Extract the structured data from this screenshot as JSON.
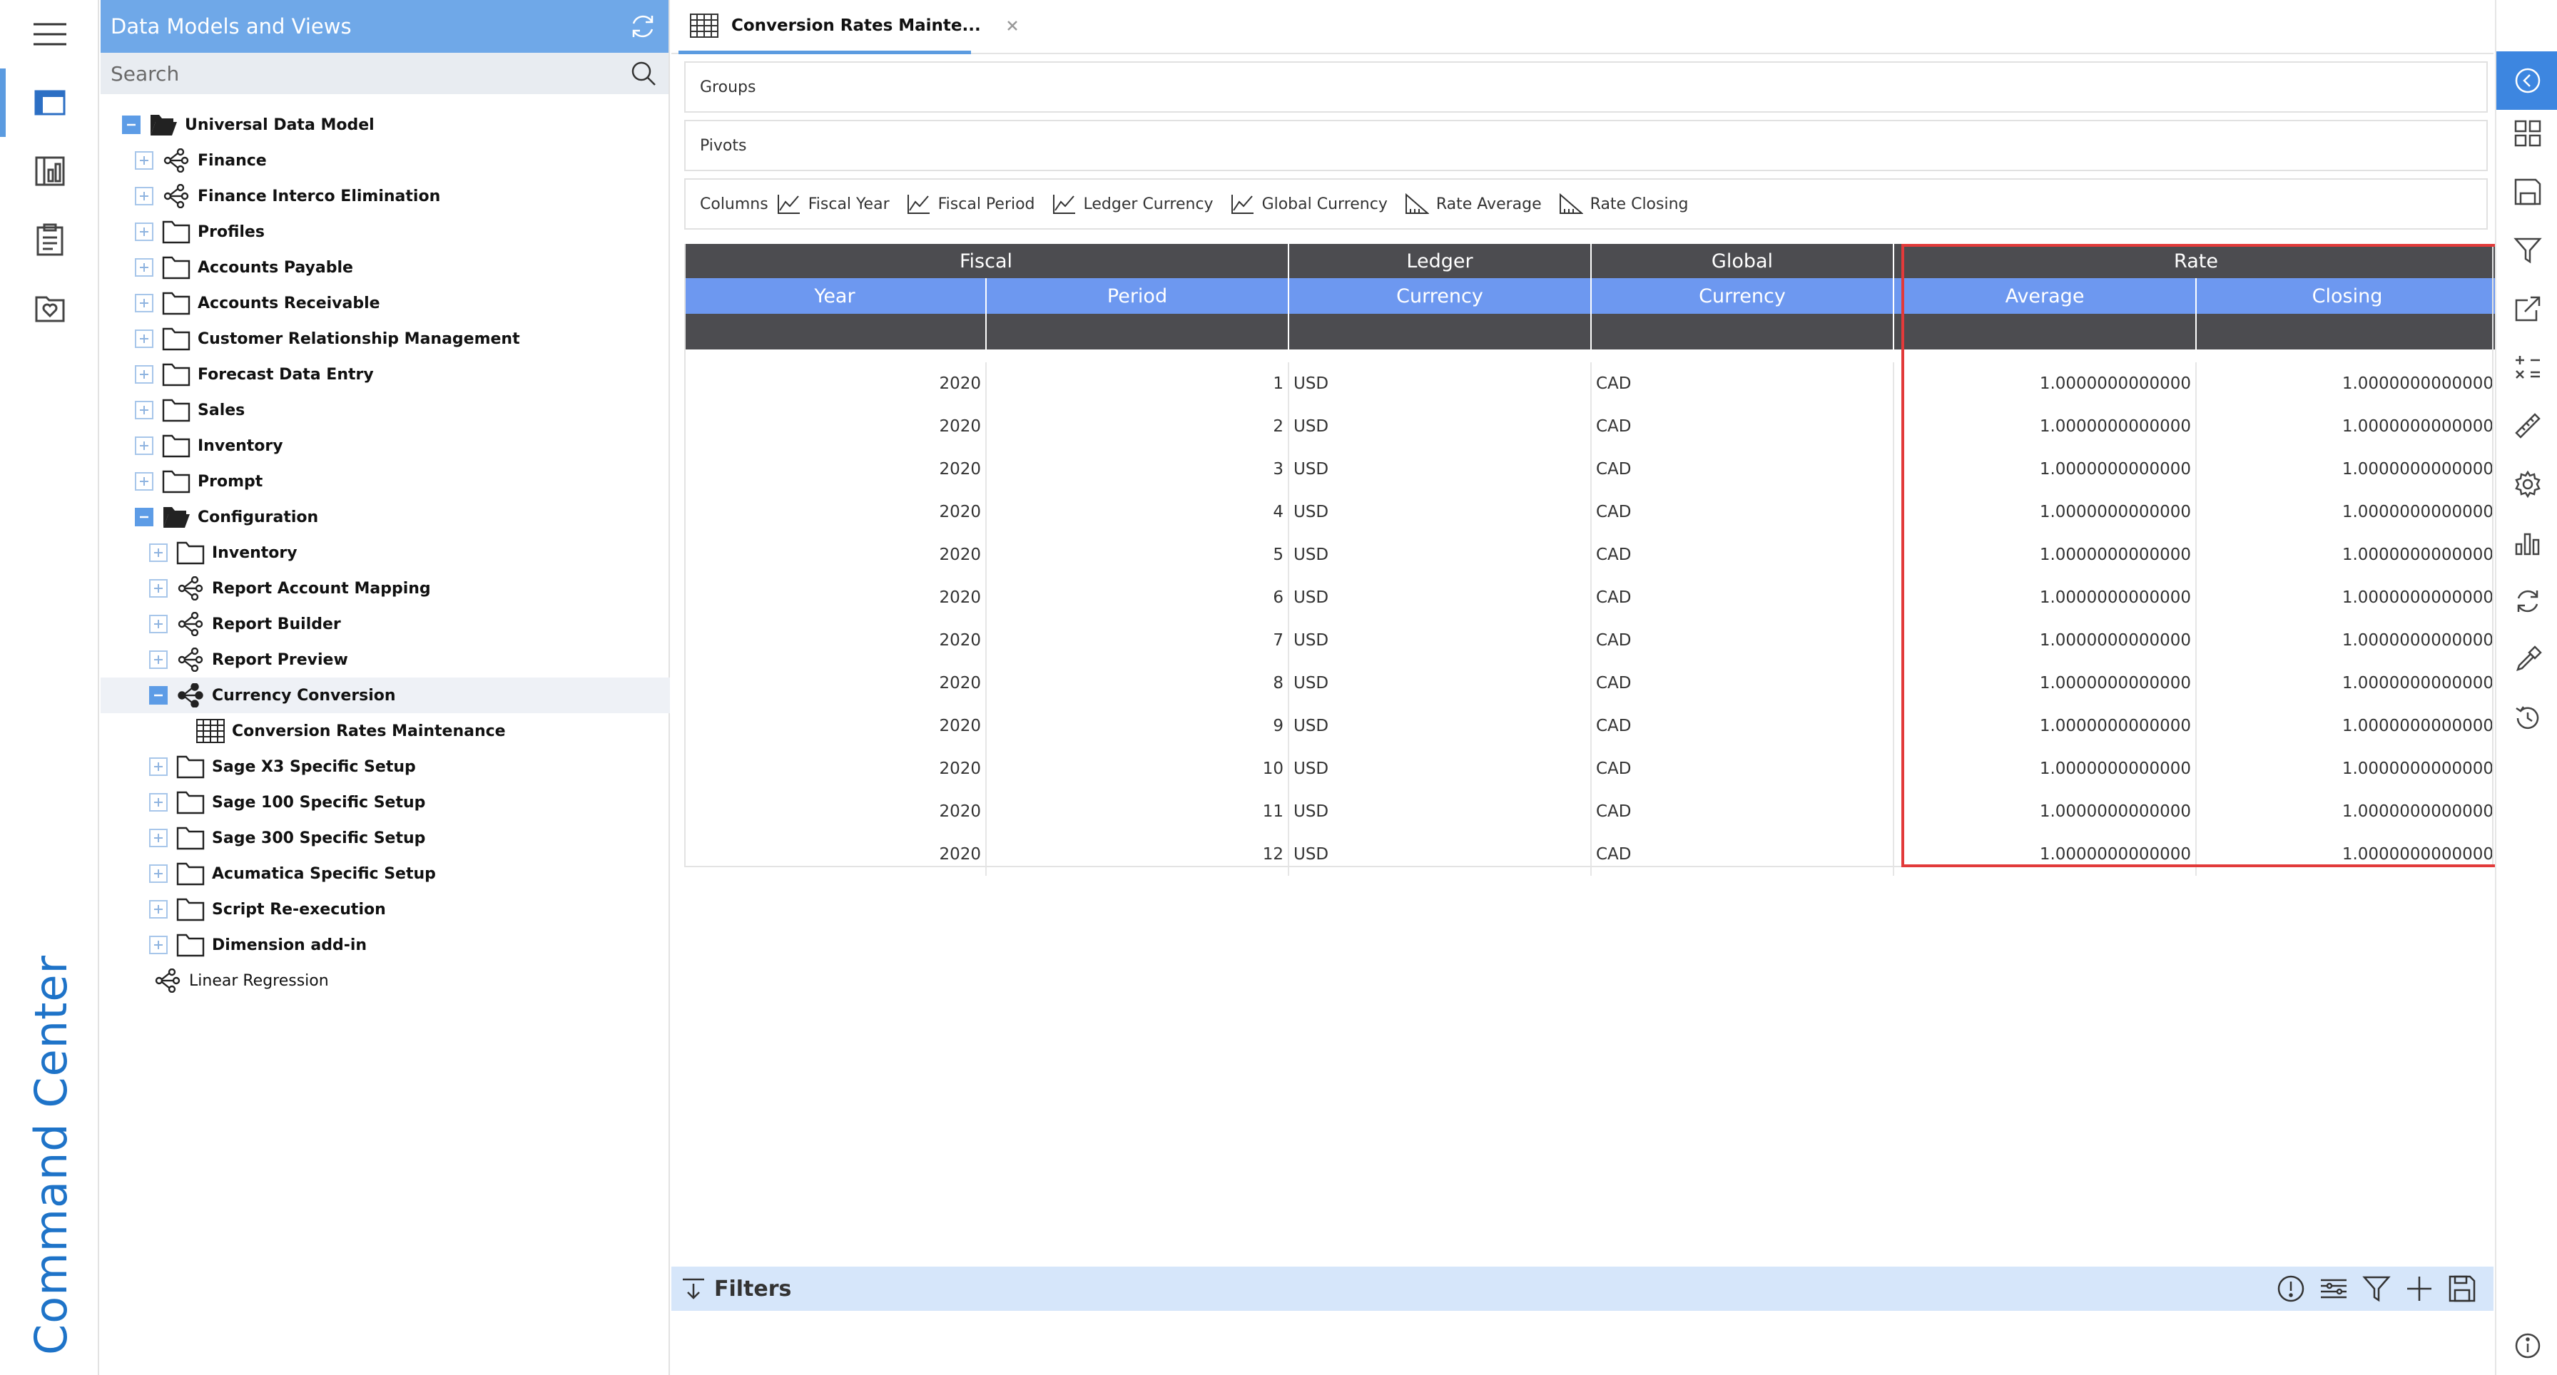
{
  "rail": {
    "brand": "Command Center",
    "icons": [
      "menu-icon",
      "data-models-icon",
      "reports-icon",
      "clipboard-icon",
      "favorites-icon"
    ]
  },
  "tree": {
    "title": "Data Models and Views",
    "search_placeholder": "Search",
    "items": [
      {
        "label": "Universal Data Model",
        "level": 0,
        "icon": "folder-open",
        "toggle": "open"
      },
      {
        "label": "Finance",
        "level": 1,
        "icon": "model",
        "toggle": "closed"
      },
      {
        "label": "Finance Interco Elimination",
        "level": 1,
        "icon": "model",
        "toggle": "closed"
      },
      {
        "label": "Profiles",
        "level": 1,
        "icon": "folder",
        "toggle": "closed"
      },
      {
        "label": "Accounts Payable",
        "level": 1,
        "icon": "folder",
        "toggle": "closed"
      },
      {
        "label": "Accounts Receivable",
        "level": 1,
        "icon": "folder",
        "toggle": "closed"
      },
      {
        "label": "Customer Relationship Management",
        "level": 1,
        "icon": "folder",
        "toggle": "closed"
      },
      {
        "label": "Forecast Data Entry",
        "level": 1,
        "icon": "folder",
        "toggle": "closed"
      },
      {
        "label": "Sales",
        "level": 1,
        "icon": "folder",
        "toggle": "closed"
      },
      {
        "label": "Inventory",
        "level": 1,
        "icon": "folder",
        "toggle": "closed"
      },
      {
        "label": "Prompt",
        "level": 1,
        "icon": "folder",
        "toggle": "closed"
      },
      {
        "label": "Configuration",
        "level": 1,
        "icon": "folder-open",
        "toggle": "open"
      },
      {
        "label": "Inventory",
        "level": 2,
        "icon": "folder",
        "toggle": "closed"
      },
      {
        "label": "Report Account Mapping",
        "level": 2,
        "icon": "model",
        "toggle": "closed"
      },
      {
        "label": "Report Builder",
        "level": 2,
        "icon": "model",
        "toggle": "closed"
      },
      {
        "label": "Report Preview",
        "level": 2,
        "icon": "model",
        "toggle": "closed"
      },
      {
        "label": "Currency Conversion",
        "level": 2,
        "icon": "model-dark",
        "toggle": "open",
        "selected": true
      },
      {
        "label": "Conversion Rates Maintenance",
        "level": 3,
        "icon": "grid",
        "toggle": "none"
      },
      {
        "label": "Sage X3 Specific Setup",
        "level": 2,
        "icon": "folder",
        "toggle": "closed"
      },
      {
        "label": "Sage 100 Specific Setup",
        "level": 2,
        "icon": "folder",
        "toggle": "closed"
      },
      {
        "label": "Sage 300 Specific Setup",
        "level": 2,
        "icon": "folder",
        "toggle": "closed"
      },
      {
        "label": "Acumatica Specific Setup",
        "level": 2,
        "icon": "folder",
        "toggle": "closed"
      },
      {
        "label": "Script Re-execution",
        "level": 2,
        "icon": "folder",
        "toggle": "closed"
      },
      {
        "label": "Dimension add-in",
        "level": 2,
        "icon": "folder",
        "toggle": "closed"
      },
      {
        "label": "Linear Regression",
        "level": 1,
        "icon": "model",
        "toggle": "none",
        "plain": true
      }
    ]
  },
  "tab": {
    "title": "Conversion Rates Mainte..."
  },
  "zones": {
    "groups": "Groups",
    "pivots": "Pivots",
    "columns": "Columns"
  },
  "columns_chips": [
    {
      "label": "Fiscal Year",
      "icon": "dimension-icon"
    },
    {
      "label": "Fiscal Period",
      "icon": "dimension-icon"
    },
    {
      "label": "Ledger Currency",
      "icon": "dimension-icon"
    },
    {
      "label": "Global Currency",
      "icon": "dimension-icon"
    },
    {
      "label": "Rate Average",
      "icon": "measure-icon"
    },
    {
      "label": "Rate Closing",
      "icon": "measure-icon"
    }
  ],
  "grid": {
    "group_headers": [
      {
        "label": "Fiscal",
        "span": 2
      },
      {
        "label": "Ledger",
        "span": 1
      },
      {
        "label": "Global",
        "span": 1
      },
      {
        "label": "Rate",
        "span": 2
      }
    ],
    "sub_headers": [
      "Year",
      "Period",
      "Currency",
      "Currency",
      "Average",
      "Closing"
    ],
    "rows": [
      [
        "2020",
        "1",
        "USD",
        "CAD",
        "1.0000000000000",
        "1.0000000000000"
      ],
      [
        "2020",
        "2",
        "USD",
        "CAD",
        "1.0000000000000",
        "1.0000000000000"
      ],
      [
        "2020",
        "3",
        "USD",
        "CAD",
        "1.0000000000000",
        "1.0000000000000"
      ],
      [
        "2020",
        "4",
        "USD",
        "CAD",
        "1.0000000000000",
        "1.0000000000000"
      ],
      [
        "2020",
        "5",
        "USD",
        "CAD",
        "1.0000000000000",
        "1.0000000000000"
      ],
      [
        "2020",
        "6",
        "USD",
        "CAD",
        "1.0000000000000",
        "1.0000000000000"
      ],
      [
        "2020",
        "7",
        "USD",
        "CAD",
        "1.0000000000000",
        "1.0000000000000"
      ],
      [
        "2020",
        "8",
        "USD",
        "CAD",
        "1.0000000000000",
        "1.0000000000000"
      ],
      [
        "2020",
        "9",
        "USD",
        "CAD",
        "1.0000000000000",
        "1.0000000000000"
      ],
      [
        "2020",
        "10",
        "USD",
        "CAD",
        "1.0000000000000",
        "1.0000000000000"
      ],
      [
        "2020",
        "11",
        "USD",
        "CAD",
        "1.0000000000000",
        "1.0000000000000"
      ],
      [
        "2020",
        "12",
        "USD",
        "CAD",
        "1.0000000000000",
        "1.0000000000000"
      ]
    ]
  },
  "filters": {
    "label": "Filters",
    "tools": [
      "info-icon",
      "list-settings-icon",
      "filter-icon",
      "add-icon",
      "save-icon"
    ]
  },
  "right_toolbar": [
    "collapse-left-icon",
    "layout-grid-icon",
    "save-icon",
    "filter-icon",
    "export-icon",
    "calculator-icon",
    "ruler-icon",
    "settings-icon",
    "bar-chart-icon",
    "refresh-icon",
    "eyedropper-icon",
    "history-icon",
    "info-icon"
  ],
  "colors": {
    "accent": "#5b9be0",
    "header_dark": "#4c4c50",
    "header_blue": "#6d98f0",
    "highlight": "#e23a3a",
    "brand": "#1e73c8"
  }
}
